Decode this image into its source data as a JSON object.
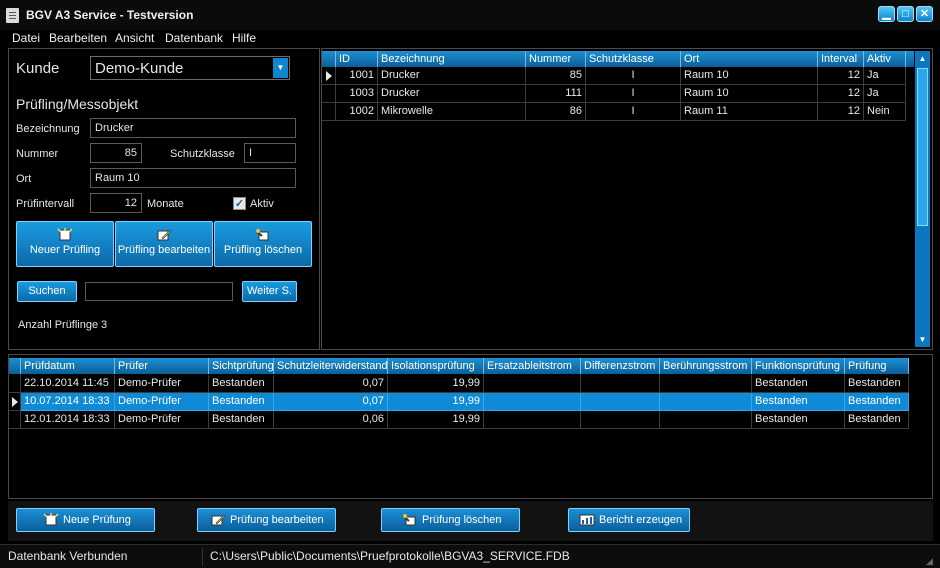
{
  "window": {
    "title": "BGV A3 Service - Testversion",
    "min": "▁",
    "max": "□",
    "close": "✕"
  },
  "menu": [
    "Datei",
    "Bearbeiten",
    "Ansicht",
    "Datenbank",
    "Hilfe"
  ],
  "customer": {
    "label": "Kunde",
    "value": "Demo-Kunde"
  },
  "device": {
    "section_title": "Prüfling/Messobjekt",
    "bezeichnung_label": "Bezeichnung",
    "bezeichnung": "Drucker",
    "nummer_label": "Nummer",
    "nummer": "85",
    "schutzklasse_label": "Schutzklasse",
    "schutzklasse": "I",
    "ort_label": "Ort",
    "ort": "Raum 10",
    "intervall_label": "Prüfintervall",
    "intervall": "12",
    "monate": "Monate",
    "aktiv_label": "Aktiv"
  },
  "actions": {
    "neu": "Neuer Prüfling",
    "bearbeiten": "Prüfling bearbeiten",
    "loeschen": "Prüfling löschen"
  },
  "search": {
    "button": "Suchen",
    "value": "",
    "weiter": "Weiter S."
  },
  "count": {
    "label": "Anzahl Prüflinge",
    "value": "3"
  },
  "devices_table": {
    "columns": [
      "ID",
      "Bezeichnung",
      "Nummer",
      "Schutzklasse",
      "Ort",
      "Interval",
      "Aktiv"
    ],
    "rows": [
      [
        "1001",
        "Drucker",
        "85",
        "I",
        "Raum 10",
        "12",
        "Ja"
      ],
      [
        "1003",
        "Drucker",
        "111",
        "I",
        "Raum 10",
        "12",
        "Ja"
      ],
      [
        "1002",
        "Mikrowelle",
        "86",
        "I",
        "Raum 11",
        "12",
        "Nein"
      ]
    ]
  },
  "tests_table": {
    "columns": [
      "Prüfdatum",
      "Prüfer",
      "Sichtprüfung",
      "Schutzleiterwiderstand",
      "Isolationsprüfung",
      "Ersatzableitstrom",
      "Differenzstrom",
      "Berührungsstrom",
      "Funktionsprüfung",
      "Prüfung"
    ],
    "rows": [
      [
        "22.10.2014 11:45",
        "Demo-Prüfer",
        "Bestanden",
        "0,07",
        "19,99",
        "",
        "",
        "",
        "Bestanden",
        "Bestanden"
      ],
      [
        "10.07.2014 18:33",
        "Demo-Prüfer",
        "Bestanden",
        "0,07",
        "19,99",
        "",
        "",
        "",
        "Bestanden",
        "Bestanden"
      ],
      [
        "12.01.2014 18:33",
        "Demo-Prüfer",
        "Bestanden",
        "0,06",
        "19,99",
        "",
        "",
        "",
        "Bestanden",
        "Bestanden"
      ]
    ]
  },
  "bottom_buttons": {
    "neu": "Neue Prüfung",
    "bearbeiten": "Prüfung bearbeiten",
    "loeschen": "Prüfung löschen",
    "bericht": "Bericht erzeugen"
  },
  "status": {
    "left": "Datenbank Verbunden",
    "path": "C:\\Users\\Public\\Documents\\Pruefprotokolle\\BGVA3_SERVICE.FDB"
  },
  "colors": {
    "accent": "#0f8ad6",
    "header": "#0a5f98",
    "background": "#000000"
  }
}
